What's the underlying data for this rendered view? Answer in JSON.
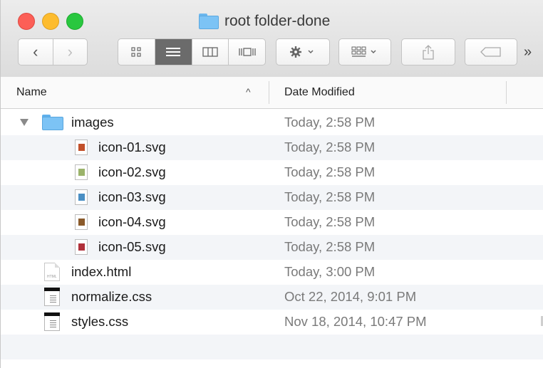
{
  "window": {
    "title": "root folder-done",
    "overflow_glyph": "»"
  },
  "toolbar": {
    "back_glyph": "‹",
    "forward_glyph": "›",
    "view_modes": [
      {
        "icon": "icon-view-icon",
        "active": false
      },
      {
        "icon": "list-view-icon",
        "active": true
      },
      {
        "icon": "column-view-icon",
        "active": false
      },
      {
        "icon": "cover-flow-icon",
        "active": false
      }
    ]
  },
  "columns": {
    "name": "Name",
    "sort_indicator": "^",
    "date_modified": "Date Modified"
  },
  "rows": [
    {
      "name": "images",
      "date": "Today, 2:58 PM",
      "kind": "folder",
      "expanded": true
    },
    {
      "name": "icon-01.svg",
      "date": "Today, 2:58 PM",
      "kind": "svg",
      "color": "#c2502a"
    },
    {
      "name": "icon-02.svg",
      "date": "Today, 2:58 PM",
      "kind": "svg",
      "color": "#9bb36a"
    },
    {
      "name": "icon-03.svg",
      "date": "Today, 2:58 PM",
      "kind": "svg",
      "color": "#4a8fc4"
    },
    {
      "name": "icon-04.svg",
      "date": "Today, 2:58 PM",
      "kind": "svg",
      "color": "#8a5a2a"
    },
    {
      "name": "icon-05.svg",
      "date": "Today, 2:58 PM",
      "kind": "svg",
      "color": "#b0303a"
    },
    {
      "name": "index.html",
      "date": "Today, 3:00 PM",
      "kind": "html",
      "tag": "HTML"
    },
    {
      "name": "normalize.css",
      "date": "Oct 22, 2014, 9:01 PM",
      "kind": "css"
    },
    {
      "name": "styles.css",
      "date": "Nov 18, 2014, 10:47 PM",
      "kind": "css"
    }
  ],
  "colors": {
    "folder": "#7cc3f5",
    "selected_view": "#6b6b6b",
    "close": "#fc5f57",
    "minimize": "#fdbc2e",
    "maximize": "#29c73f"
  }
}
